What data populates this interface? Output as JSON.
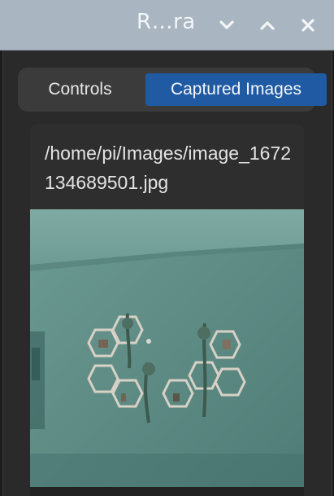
{
  "window": {
    "title": "R…ra",
    "controls": {
      "minimize_icon": "chevron-down-icon",
      "maximize_icon": "chevron-up-icon",
      "close_icon": "close-icon"
    }
  },
  "tabs": [
    {
      "label": "Controls",
      "active": false
    },
    {
      "label": "Captured Images",
      "active": true
    }
  ],
  "captured": {
    "path": "/home/pi/Images/image_1672134689501.jpg"
  },
  "colors": {
    "titlebar": "#a9b5c1",
    "active_tab": "#1f5aa3",
    "background": "#2a2a2a"
  }
}
